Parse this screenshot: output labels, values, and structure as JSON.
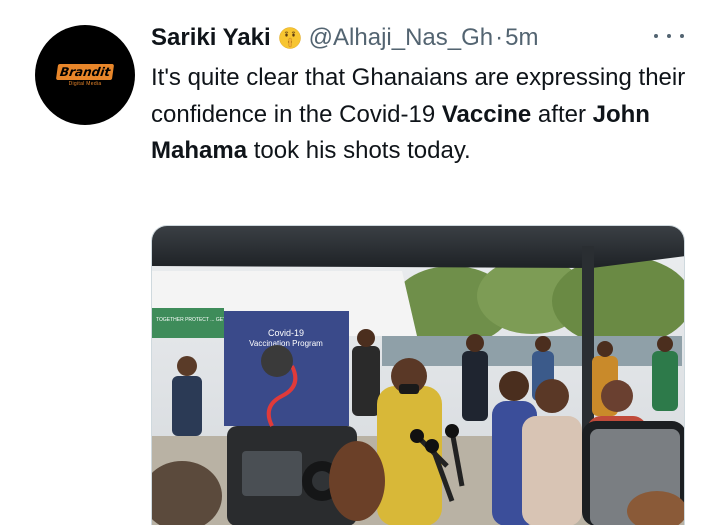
{
  "tweet": {
    "display_name": "Sariki Yaki",
    "emoji": "shushing-face",
    "handle": "@Alhaji_Nas_Gh",
    "separator": "·",
    "time": "5m",
    "text": {
      "part1": "It's quite clear that Ghanaians are expressing their confidence in the Covid-19 ",
      "bold1": "Vaccine",
      "part2": " after ",
      "bold2": "John Mahama",
      "part3": " took his shots today."
    }
  },
  "avatar": {
    "logo_text": "Brandit",
    "logo_subtext": "Digital Media"
  },
  "photo": {
    "banner_title": "Covid-19",
    "banner_subtitle": "Vaccination Program",
    "sign_text": "TOGETHER PROTECT ... GET VACCINATED"
  },
  "colors": {
    "text": "#0f1419",
    "muted": "#536471",
    "logo_accent": "#e8862a"
  }
}
